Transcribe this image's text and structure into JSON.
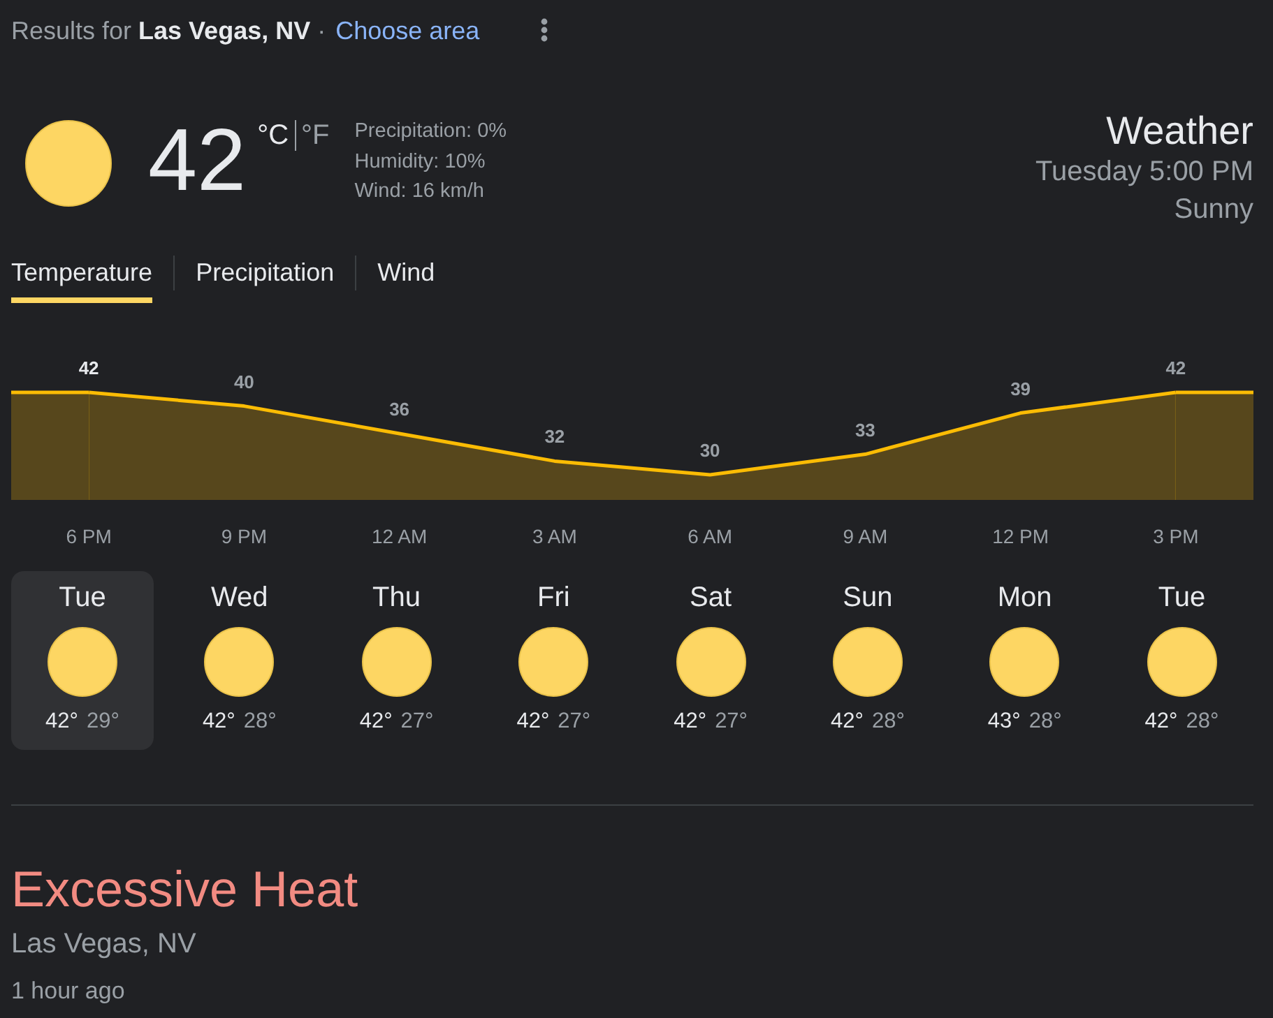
{
  "header": {
    "results_text": "Results for **Las Vegas, NV** ·",
    "link": "Choose area"
  },
  "current": {
    "temperature": "42",
    "units": [
      {
        "label": "°C",
        "selected": true
      },
      {
        "label": "°F",
        "selected": false
      }
    ],
    "details": [
      "Precipitation: 0%",
      "Humidity: 10%",
      "Wind: 16 km/h"
    ]
  },
  "summary": {
    "title": "Weather",
    "time": "Tuesday 5:00 PM",
    "condition": "Sunny"
  },
  "tabs": [
    {
      "label": "Temperature",
      "selected": true
    },
    {
      "label": "Precipitation",
      "selected": false
    },
    {
      "label": "Wind",
      "selected": false
    }
  ],
  "chart": {
    "chart_data": {
      "type": "area",
      "categories": [
        "6 PM",
        "9 PM",
        "12 AM",
        "3 AM",
        "6 AM",
        "9 AM",
        "12 PM",
        "3 PM"
      ],
      "series": [
        {
          "color": "#fbbc04",
          "values": [
            42,
            40,
            36,
            32,
            30,
            33,
            39,
            42
          ]
        }
      ],
      "data_labels": true
    }
  },
  "forecast": [
    {
      "day": "Tue",
      "high": "42°",
      "low": "29°",
      "selected": true
    },
    {
      "day": "Wed",
      "high": "42°",
      "low": "28°",
      "selected": false
    },
    {
      "day": "Thu",
      "high": "42°",
      "low": "27°",
      "selected": false
    },
    {
      "day": "Fri",
      "high": "42°",
      "low": "27°",
      "selected": false
    },
    {
      "day": "Sat",
      "high": "42°",
      "low": "27°",
      "selected": false
    },
    {
      "day": "Sun",
      "high": "42°",
      "low": "28°",
      "selected": false
    },
    {
      "day": "Mon",
      "high": "43°",
      "low": "28°",
      "selected": false
    },
    {
      "day": "Tue",
      "high": "42°",
      "low": "28°",
      "selected": false
    }
  ],
  "alert": {
    "title": "Excessive Heat",
    "location": "Las Vegas, NV",
    "time": "1 hour ago"
  }
}
